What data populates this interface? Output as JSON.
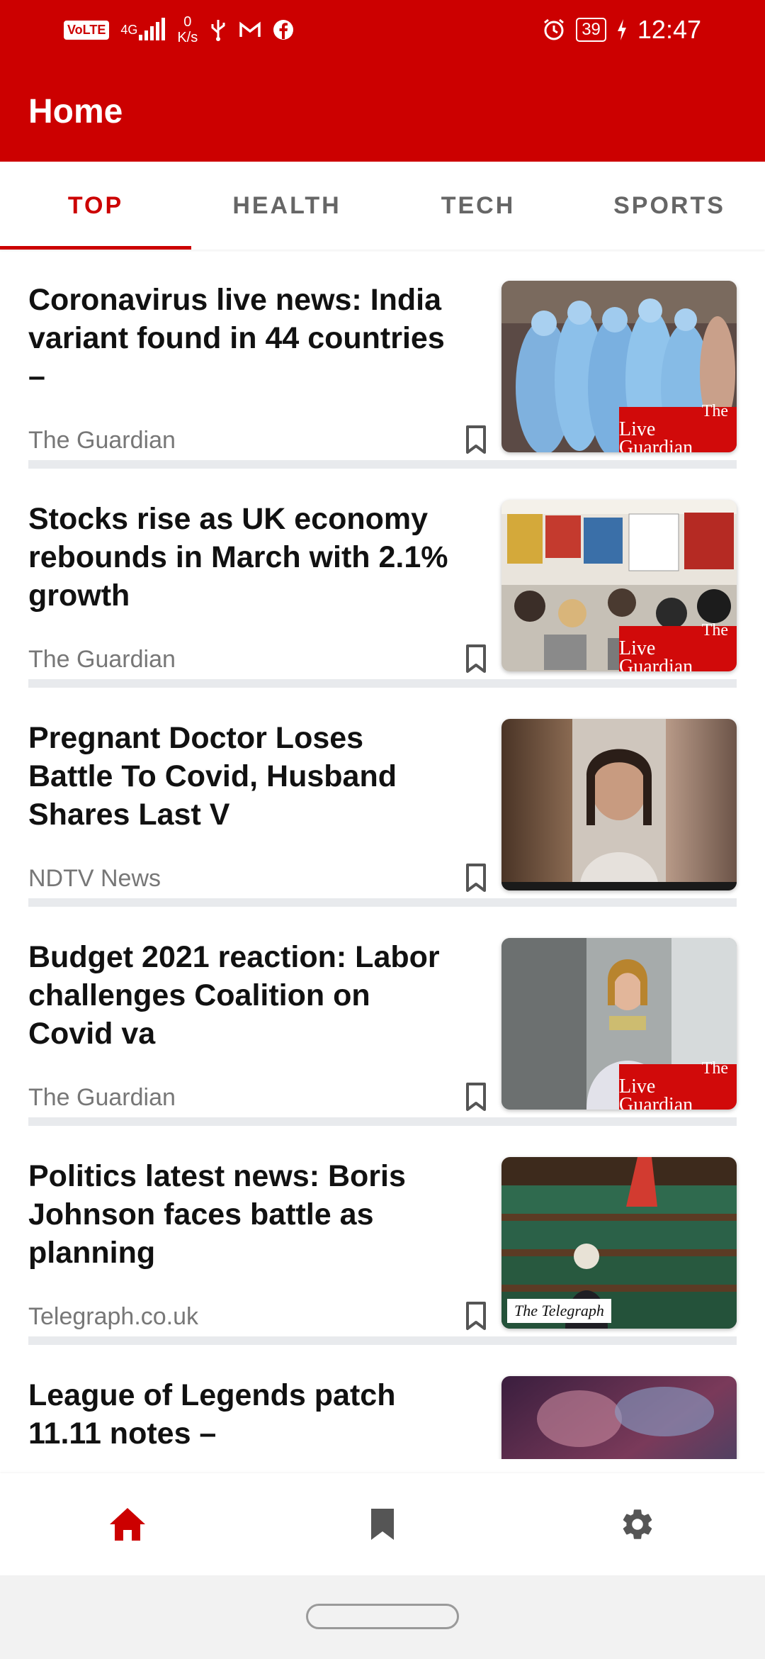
{
  "status_bar": {
    "volte": "VoLTE",
    "network_top": "4G",
    "speed_value": "0",
    "speed_unit": "K/s",
    "battery": "39",
    "time": "12:47"
  },
  "header": {
    "title": "Home"
  },
  "tabs": [
    {
      "label": "TOP",
      "active": true
    },
    {
      "label": "HEALTH",
      "active": false
    },
    {
      "label": "TECH",
      "active": false
    },
    {
      "label": "SPORTS",
      "active": false
    }
  ],
  "articles": [
    {
      "headline": "Coronavirus live news: India variant found in 44 countries –",
      "source": "The Guardian",
      "badge_line1": "The",
      "badge_line2": "Live Guardian"
    },
    {
      "headline": "Stocks rise as UK economy rebounds in March with 2.1% growth",
      "source": "The Guardian",
      "badge_line1": "The",
      "badge_line2": "Live Guardian"
    },
    {
      "headline": "Pregnant Doctor Loses Battle To Covid, Husband Shares Last V",
      "source": "NDTV News"
    },
    {
      "headline": "Budget 2021 reaction: Labor challenges Coalition on Covid va",
      "source": "The Guardian",
      "badge_line1": "The",
      "badge_line2": "Live Guardian"
    },
    {
      "headline": "Politics latest news: Boris Johnson faces battle as planning",
      "source": "Telegraph.co.uk",
      "badge_line1": "The Telegraph"
    },
    {
      "headline": "League of Legends patch 11.11 notes –",
      "source": ""
    }
  ],
  "bottom_nav": [
    {
      "icon": "home-icon",
      "active": true
    },
    {
      "icon": "bookmark-icon",
      "active": false
    },
    {
      "icon": "gear-icon",
      "active": false
    }
  ],
  "colors": {
    "brand_red": "#cc0000",
    "separator": "#e8eaed",
    "inactive_icon": "#555555"
  }
}
